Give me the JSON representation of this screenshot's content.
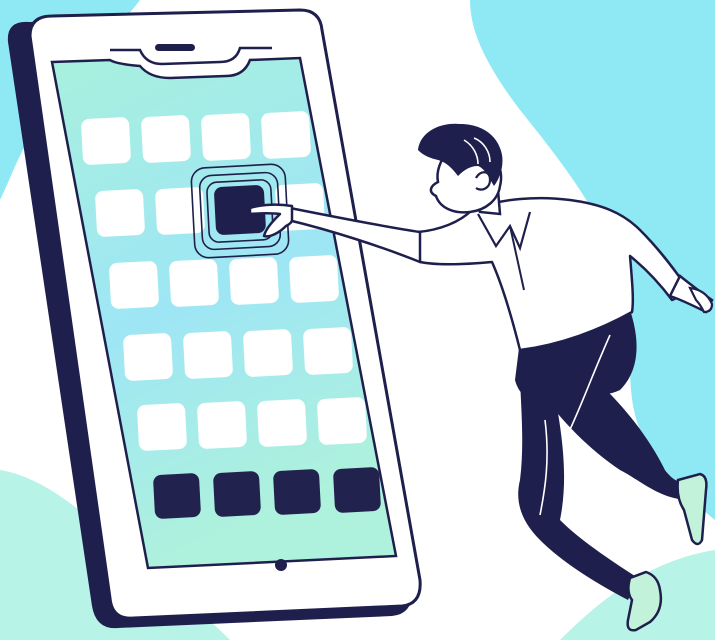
{
  "scene": {
    "subject": "person-tapping-app-icon-on-giant-smartphone",
    "colors": {
      "background_blob": "#8fe9f4",
      "background_blob_bottom": "#b7f3e6",
      "outline": "#1f1f4d",
      "phone_body": "#ffffff",
      "screen_top": "#a8f0dd",
      "screen_mid": "#9ee6f5",
      "screen_bottom": "#aef1dc",
      "app_tile": "#ffffff",
      "dock_tile": "#22224f",
      "selected_tile": "#22224f",
      "shirt": "#ffffff",
      "pants": "#22224f",
      "shoes": "#c2f2da"
    },
    "app_grid": {
      "rows": 5,
      "columns": 4,
      "selected_row": 2,
      "selected_column": 3
    },
    "dock_apps": 4
  }
}
